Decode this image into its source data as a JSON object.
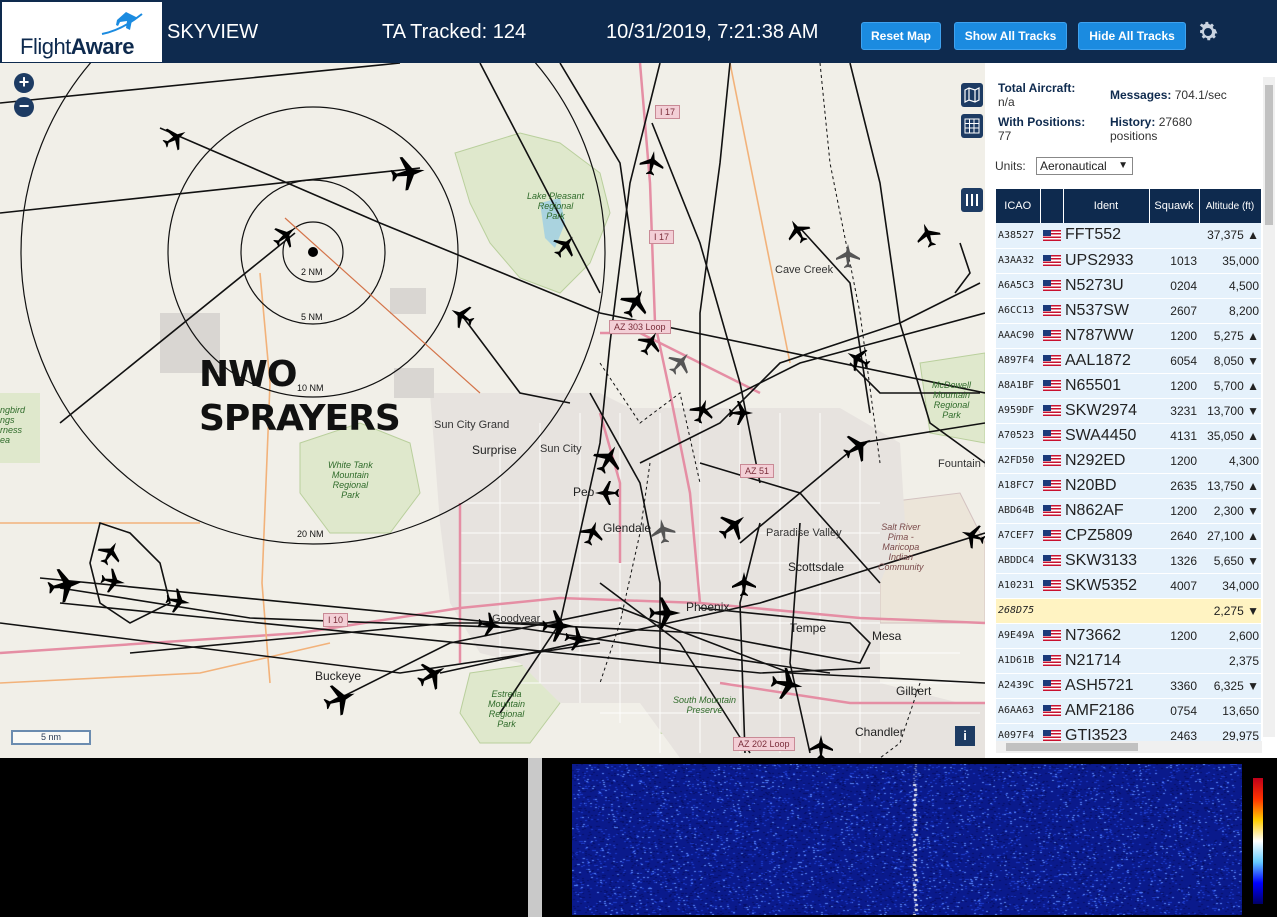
{
  "header": {
    "logo": "FlightAware",
    "app_title": "SKYVIEW",
    "ta_tracked": "TA Tracked: 124",
    "datetime": "10/31/2019, 7:21:38 AM",
    "buttons": {
      "reset": "Reset Map",
      "show": "Show All Tracks",
      "hide": "Hide All Tracks"
    },
    "settings_icon": "gear-icon"
  },
  "map": {
    "overlay_text_line1": "NWO",
    "overlay_text_line2": "SPRAYERS",
    "ring_labels": [
      "2 NM",
      "5 NM",
      "10 NM",
      "20 NM"
    ],
    "scale": "5 nm",
    "zoom_in": "+",
    "zoom_out": "−",
    "info": "i",
    "places": {
      "cave_creek": "Cave Creek",
      "sun_city_grand": "Sun City Grand",
      "surprise": "Surprise",
      "sun_city": "Sun City",
      "peoria": "Peo",
      "glendale": "Glendale",
      "paradise_valley": "Paradise Valley",
      "scottsdale": "Scottsdale",
      "phoenix": "Phoenix",
      "tempe": "Tempe",
      "mesa": "Mesa",
      "gilbert": "Gilbert",
      "chandler": "Chandler",
      "buckeye": "Buckeye",
      "goodyear": "Goodyear",
      "fountain_hills": "Fountain H"
    },
    "parks": {
      "lake_pleasant": "Lake Pleasant\nRegional\nPark",
      "white_tank": "White Tank\nMountain\nRegional\nPark",
      "mcdowell": "McDowell\nMountain\nRegional\nPark",
      "estrella": "Estrella\nMountain\nRegional\nPark",
      "south_mountain": "South Mountain\nPreserve",
      "salt_river": "Salt River\nPima -\nMaricopa\nIndian\nCommunity",
      "hassayampa": "ngbird\nngs\nrness\nea"
    },
    "shields": {
      "i17a": "I 17",
      "i17b": "I 17",
      "az303": "AZ 303 Loop",
      "az51": "AZ 51",
      "i10": "I 10",
      "az202": "AZ 202 Loop"
    }
  },
  "panel": {
    "total_aircraft_label": "Total Aircraft:",
    "total_aircraft_value": "n/a",
    "messages_label": "Messages:",
    "messages_value": "704.1/sec",
    "with_positions_label": "With Positions:",
    "with_positions_value": "77",
    "history_label": "History:",
    "history_value": "27680",
    "history_unit": "positions",
    "units_label": "Units:",
    "units_value": "Aeronautical",
    "columns": [
      "ICAO",
      "",
      "Ident",
      "Squawk",
      "Altitude (ft)"
    ],
    "rows": [
      {
        "icao": "A38527",
        "ident": "FFT552",
        "squawk": "",
        "alt": "37,375 ▲"
      },
      {
        "icao": "A3AA32",
        "ident": "UPS2933",
        "squawk": "1013",
        "alt": "35,000"
      },
      {
        "icao": "A6A5C3",
        "ident": "N5273U",
        "squawk": "0204",
        "alt": "4,500"
      },
      {
        "icao": "A6CC13",
        "ident": "N537SW",
        "squawk": "2607",
        "alt": "8,200"
      },
      {
        "icao": "AAAC90",
        "ident": "N787WW",
        "squawk": "1200",
        "alt": "5,275 ▲"
      },
      {
        "icao": "A897F4",
        "ident": "AAL1872",
        "squawk": "6054",
        "alt": "8,050 ▼"
      },
      {
        "icao": "A8A1BF",
        "ident": "N65501",
        "squawk": "1200",
        "alt": "5,700 ▲"
      },
      {
        "icao": "A959DF",
        "ident": "SKW2974",
        "squawk": "3231",
        "alt": "13,700 ▼"
      },
      {
        "icao": "A70523",
        "ident": "SWA4450",
        "squawk": "4131",
        "alt": "35,050 ▲"
      },
      {
        "icao": "A2FD50",
        "ident": "N292ED",
        "squawk": "1200",
        "alt": "4,300"
      },
      {
        "icao": "A18FC7",
        "ident": "N20BD",
        "squawk": "2635",
        "alt": "13,750 ▲"
      },
      {
        "icao": "ABD64B",
        "ident": "N862AF",
        "squawk": "1200",
        "alt": "2,300 ▼"
      },
      {
        "icao": "A7CEF7",
        "ident": "CPZ5809",
        "squawk": "2640",
        "alt": "27,100 ▲"
      },
      {
        "icao": "ABDDC4",
        "ident": "SKW3133",
        "squawk": "1326",
        "alt": "5,650 ▼"
      },
      {
        "icao": "A10231",
        "ident": "SKW5352",
        "squawk": "4007",
        "alt": "34,000"
      },
      {
        "icao": "268D75",
        "ident": "",
        "squawk": "",
        "alt": "2,275 ▼",
        "highlight": true,
        "noflag": true
      },
      {
        "icao": "A9E49A",
        "ident": "N73662",
        "squawk": "1200",
        "alt": "2,600"
      },
      {
        "icao": "A1D61B",
        "ident": "N21714",
        "squawk": "",
        "alt": "2,375"
      },
      {
        "icao": "A2439C",
        "ident": "ASH5721",
        "squawk": "3360",
        "alt": "6,325 ▼"
      },
      {
        "icao": "A6AA63",
        "ident": "AMF2186",
        "squawk": "0754",
        "alt": "13,650"
      },
      {
        "icao": "A097F4",
        "ident": "GTI3523",
        "squawk": "2463",
        "alt": "29,975"
      }
    ]
  },
  "colors": {
    "header_bg": "#0e2a4e",
    "button_bg": "#1b8be0",
    "table_row": "#e5f1fb",
    "highlight_row": "#fff3c2"
  }
}
